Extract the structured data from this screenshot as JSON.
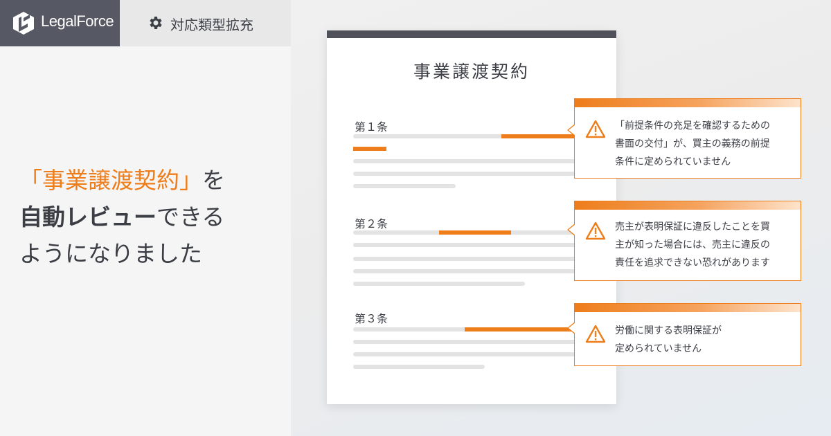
{
  "header": {
    "logo_text": "LegalForce",
    "tag_label": "対応類型拡充"
  },
  "headline": {
    "line1_highlight": "「事業譲渡契約」",
    "line1_rest": "を",
    "line2_bold": "自動レビュー",
    "line2_rest": "できる",
    "line3": "ようになりました"
  },
  "document": {
    "title": "事業譲渡契約",
    "articles": [
      {
        "label": "第１条"
      },
      {
        "label": "第２条"
      },
      {
        "label": "第３条"
      }
    ]
  },
  "callouts": [
    {
      "lines": [
        "「前提条件の充足を確認するための",
        "書面の交付」が、買主の義務の前提",
        "条件に定められていません"
      ]
    },
    {
      "lines": [
        "売主が表明保証に違反したことを買",
        "主が知った場合には、売主に違反の",
        "責任を追求できない恐れがあります"
      ]
    },
    {
      "lines": [
        "労働に関する表明保証が",
        "定められていません"
      ]
    }
  ],
  "colors": {
    "accent": "#ee7d1b",
    "dark": "#565963",
    "text": "#3c3e45"
  },
  "icons": {
    "logo": "legalforce-logo-icon",
    "tag": "gear-icon",
    "warning": "warning-icon"
  }
}
